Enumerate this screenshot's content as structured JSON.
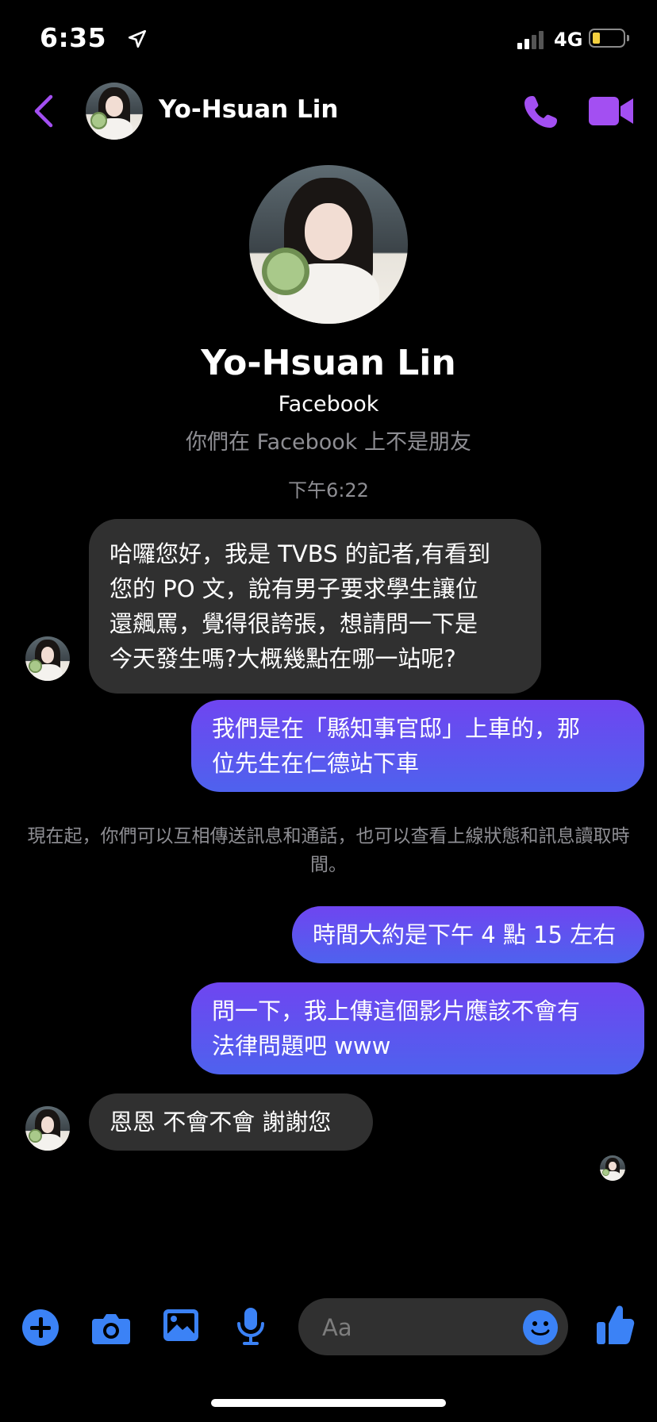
{
  "status_bar": {
    "time": "6:35",
    "network": "4G",
    "battery_icon": "battery-low-icon",
    "colors": {
      "battery_level": "#f4d03f"
    }
  },
  "header": {
    "name": "Yo-Hsuan Lin",
    "accent": "#a34ff2"
  },
  "profile": {
    "name": "Yo-Hsuan Lin",
    "platform": "Facebook",
    "relation_note": "你們在 Facebook 上不是朋友"
  },
  "conversation": {
    "timestamp": "下午6:22",
    "messages": [
      {
        "from": "them",
        "lines": [
          "哈囉您好，我是 TVBS 的記者,有看到",
          "您的 PO 文，說有男子要求學生讓位",
          "還飆罵，覺得很誇張，想請問一下是",
          "今天發生嗎?大概幾點在哪一站呢?"
        ]
      },
      {
        "from": "me",
        "lines": [
          "我們是在「縣知事官邸」上車的，那",
          "位先生在仁德站下車"
        ]
      },
      {
        "from": "me",
        "lines": [
          "時間大約是下午 4 點 15 左右"
        ]
      },
      {
        "from": "me",
        "lines": [
          "問一下，我上傳這個影片應該不會有",
          "法律問題吧 www"
        ]
      },
      {
        "from": "them",
        "lines": [
          "恩恩 不會不會 謝謝您"
        ]
      }
    ],
    "system_note": "現在起，你們可以互相傳送訊息和通話，也可以查看上線狀態和訊息讀取時間。"
  },
  "composer": {
    "placeholder": "Aa",
    "accent": "#3b82f6"
  },
  "colors": {
    "incoming_bubble": "#303030",
    "outgoing_top": "#6f45f0",
    "outgoing_bottom": "#4e62ee",
    "muted_text": "#8e8e93"
  }
}
